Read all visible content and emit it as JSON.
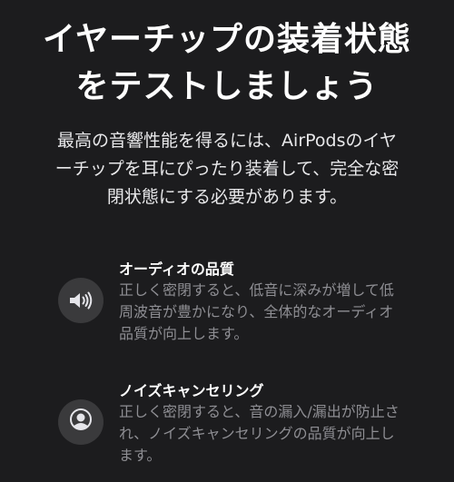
{
  "title": "イヤーチップの装着状態をテストしましょう",
  "description": "最高の音響性能を得るには、AirPodsのイヤーチップを耳にぴったり装着して、完全な密閉状態にする必要があります。",
  "features": [
    {
      "title": "オーディオの品質",
      "body": "正しく密閉すると、低音に深みが増して低周波音が豊かになり、全体的なオーディオ品質が向上します。",
      "icon": "speaker-icon"
    },
    {
      "title": "ノイズキャンセリング",
      "body": "正しく密閉すると、音の漏入/漏出が防止され、ノイズキャンセリングの品質が向上します。",
      "icon": "person-noise-icon"
    }
  ],
  "colors": {
    "background": "#1c1c1e",
    "icon_circle": "#3a3a3c",
    "secondary_text": "#8e8e93"
  }
}
